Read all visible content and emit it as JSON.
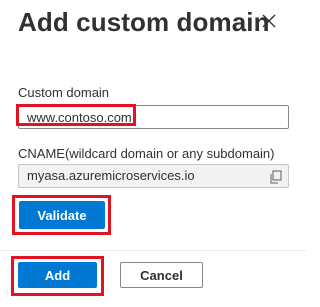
{
  "panel": {
    "title": "Add custom domain",
    "close_icon": "close-icon"
  },
  "custom_domain": {
    "label": "Custom domain",
    "value": "www.contoso.com"
  },
  "cname": {
    "label": "CNAME(wildcard domain or any subdomain)",
    "value": "myasa.azuremicroservices.io",
    "copy_icon": "copy-icon"
  },
  "buttons": {
    "validate_label": "Validate",
    "add_label": "Add",
    "cancel_label": "Cancel"
  },
  "colors": {
    "primary": "#0078d4",
    "highlight": "#e21224",
    "text": "#323130",
    "readonly_bg": "#f3f2f1"
  }
}
